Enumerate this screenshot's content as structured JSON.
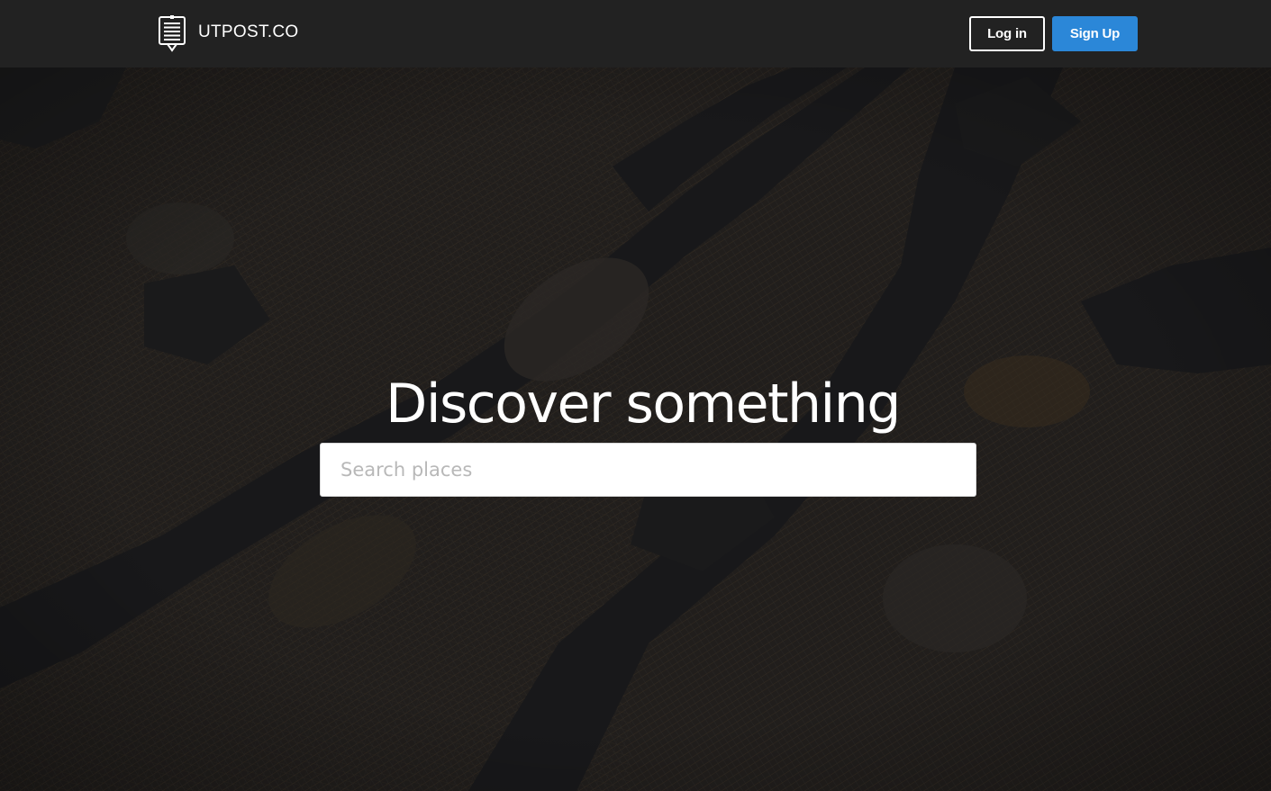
{
  "header": {
    "brand": "UTPOST.CO",
    "login_label": "Log in",
    "signup_label": "Sign Up"
  },
  "hero": {
    "title": "Discover something",
    "search_placeholder": "Search places"
  },
  "colors": {
    "header_bg": "#222222",
    "signup_bg": "#2b87d8",
    "hero_bg": "#1c1d1f",
    "city_light": "#a77b3c"
  },
  "icons": {
    "brand": "billboard-icon"
  }
}
